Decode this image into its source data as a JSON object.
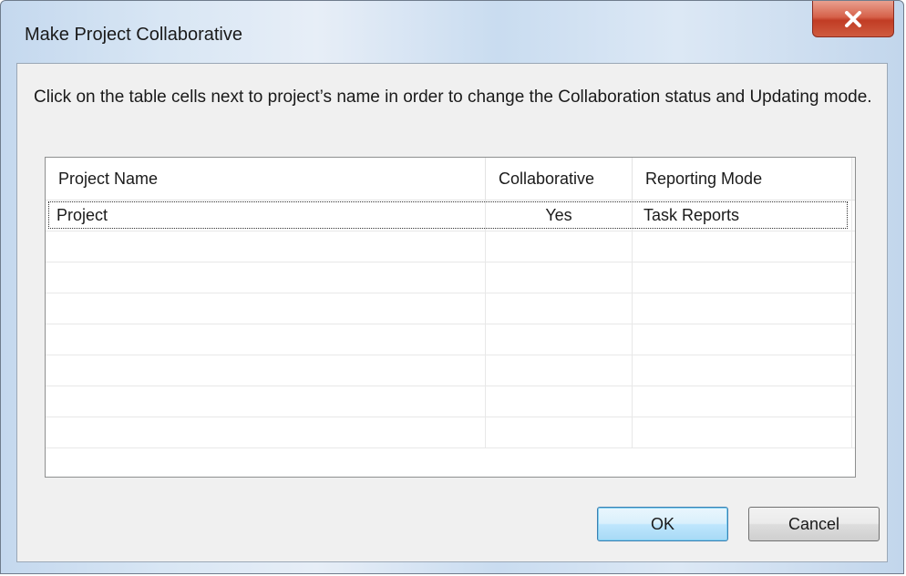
{
  "window": {
    "title": "Make Project Collaborative",
    "close_icon": "close-icon"
  },
  "instructions": "Click on the table cells next to project’s name in order to change the Collaboration status and Updating mode.",
  "table": {
    "columns": [
      "Project Name",
      "Collaborative",
      "Reporting Mode"
    ],
    "rows": [
      {
        "project_name": "Project",
        "collaborative": "Yes",
        "reporting_mode": "Task Reports",
        "selected": true
      }
    ],
    "empty_rows": 7
  },
  "buttons": {
    "ok_label": "OK",
    "cancel_label": "Cancel"
  },
  "colors": {
    "close_button": "#c13c24",
    "default_button_border": "#3c7fb1",
    "client_background": "#f0f0f0"
  }
}
